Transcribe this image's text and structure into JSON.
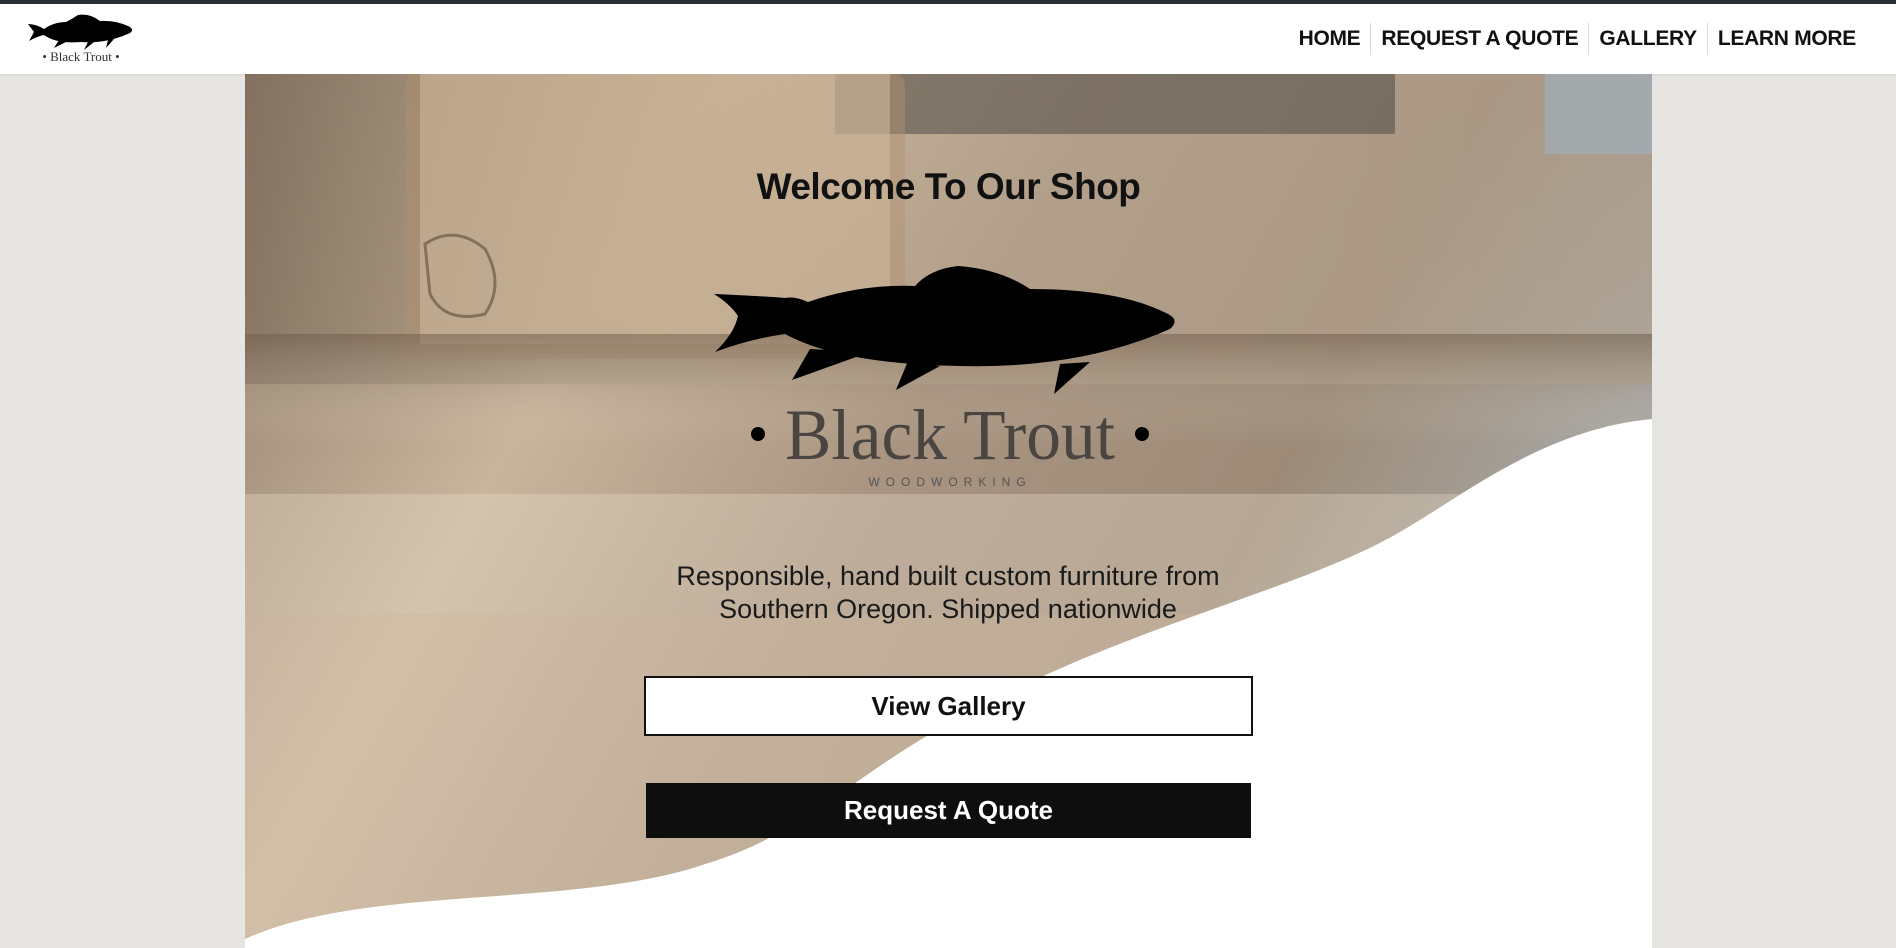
{
  "nav": {
    "logo_text": "• Black Trout •",
    "links": [
      {
        "label": "HOME"
      },
      {
        "label": "REQUEST A QUOTE"
      },
      {
        "label": "GALLERY"
      },
      {
        "label": "LEARN MORE"
      }
    ]
  },
  "hero": {
    "title": "Welcome To Our Shop",
    "logo": {
      "name": "• Black Trout •",
      "tagline": "WOODWORKING",
      "icon": "trout-fish-icon"
    },
    "description_line1": "Responsible, hand built custom furniture from",
    "description_line2": "Southern Oregon. Shipped nationwide",
    "primary_button": "View Gallery",
    "secondary_button": "Request A Quote"
  },
  "colors": {
    "page_background": "#e6e5e2",
    "top_accent": "#2b3038",
    "nav_background": "#ffffff",
    "button_dark": "#0e0e0e",
    "text_dark": "#111111"
  }
}
